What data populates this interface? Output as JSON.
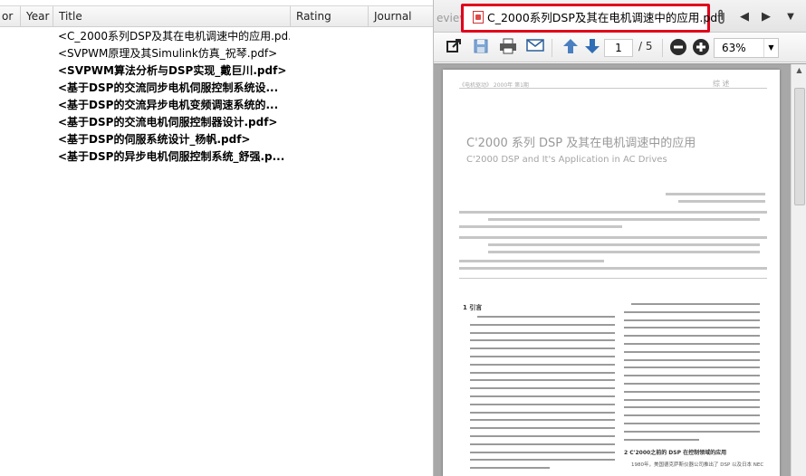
{
  "library": {
    "columns": {
      "author_fragment": "or",
      "year": "Year",
      "title": "Title",
      "rating": "Rating",
      "journal": "Journal"
    },
    "rows": [
      {
        "title": "<C_2000系列DSP及其在电机调速中的应用.pd...",
        "bold": false
      },
      {
        "title": "<SVPWM原理及其Simulink仿真_祝琴.pdf>",
        "bold": false
      },
      {
        "title": "<SVPWM算法分析与DSP实现_戴巨川.pdf>",
        "bold": true
      },
      {
        "title": "<基于DSP的交流同步电机伺服控制系统设...",
        "bold": true
      },
      {
        "title": "<基于DSP的交流异步电机变频调速系统的...",
        "bold": true
      },
      {
        "title": "<基于DSP的交流电机伺服控制器设计.pdf>",
        "bold": true
      },
      {
        "title": "<基于DSP的伺服系统设计_杨帆.pdf>",
        "bold": true
      },
      {
        "title": "<基于DSP的异步电机伺服控制系统_舒强.p...",
        "bold": true
      }
    ]
  },
  "viewer": {
    "faded_tab": "eview",
    "active_tab": "C_2000系列DSP及其在电机调速中的应用.pdf",
    "page_current": "1",
    "page_total": "/ 5",
    "zoom": "63%",
    "icons": {
      "attach": "paperclip-icon",
      "prev": "triangle-left-icon",
      "next": "triangle-right-icon",
      "menu": "dropdown-icon",
      "open_external": "external-link-icon",
      "save": "floppy-disk-icon",
      "print": "printer-icon",
      "email": "envelope-icon",
      "page_up": "arrow-up-icon",
      "page_down": "arrow-down-icon",
      "zoom_out": "minus-circle-icon",
      "zoom_in": "plus-circle-icon"
    },
    "colors": {
      "highlight_border": "#e0001a",
      "nav_arrow": "#4a7fc0",
      "zoom_button": "#2b2b2b"
    },
    "document": {
      "header_left": "《电机驱动》 2000年 第1期",
      "header_right": "综 述",
      "title_cn": "C'2000 系列 DSP 及其在电机调速中的应用",
      "title_en": "C'2000 DSP and It's Application in AC Drives",
      "section_1": "1  引言",
      "section_2": "2  C'2000之前的 DSP 在控制领域的应用",
      "body_start": "1980年，美国德克萨斯仪器公司推出了 DSP 以及日本 NEC"
    }
  }
}
